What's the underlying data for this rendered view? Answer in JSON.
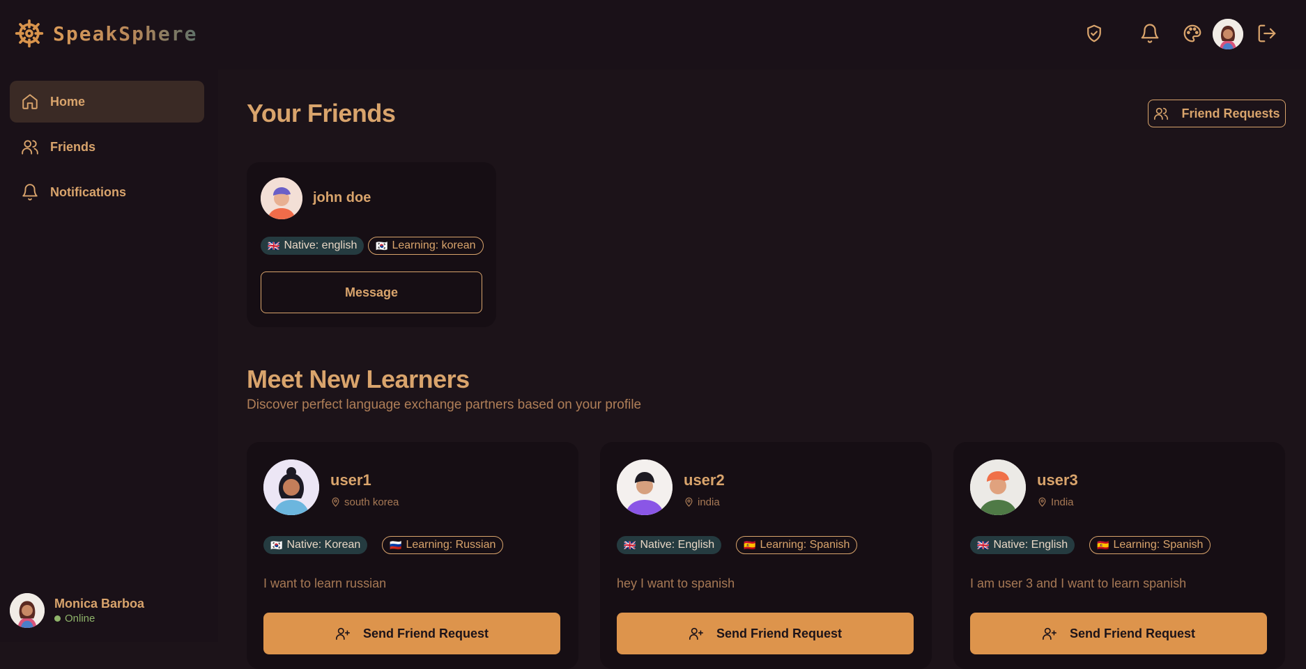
{
  "app": {
    "name": "SpeakSphere"
  },
  "sidebar": {
    "items": [
      {
        "label": "Home",
        "icon": "home-icon",
        "active": true
      },
      {
        "label": "Friends",
        "icon": "users-icon",
        "active": false
      },
      {
        "label": "Notifications",
        "icon": "bell-icon",
        "active": false
      }
    ],
    "user": {
      "name": "Monica Barboa",
      "status": "Online"
    }
  },
  "main": {
    "friends_title": "Your Friends",
    "friend_requests_label": "Friend Requests",
    "friends": [
      {
        "name": "john doe",
        "native": "Native: english",
        "native_flag": "🇬🇧",
        "learning": "Learning: korean",
        "learning_flag": "🇰🇷",
        "action": "Message"
      }
    ],
    "learners_title": "Meet New Learners",
    "learners_subtitle": "Discover perfect language exchange partners based on your profile",
    "learners": [
      {
        "name": "user1",
        "location": "south korea",
        "native": "Native: Korean",
        "native_flag": "🇰🇷",
        "learning": "Learning: Russian",
        "learning_flag": "🇷🇺",
        "bio": "I want to learn russian",
        "action": "Send Friend Request"
      },
      {
        "name": "user2",
        "location": "india",
        "native": "Native: English",
        "native_flag": "🇬🇧",
        "learning": "Learning: Spanish",
        "learning_flag": "🇪🇸",
        "bio": "hey I want to spanish",
        "action": "Send Friend Request"
      },
      {
        "name": "user3",
        "location": "India",
        "native": "Native: English",
        "native_flag": "🇬🇧",
        "learning": "Learning: Spanish",
        "learning_flag": "🇪🇸",
        "bio": "I am user 3 and I want to learn spanish",
        "action": "Send Friend Request"
      }
    ]
  },
  "colors": {
    "background": "#1c1319",
    "accent": "#d9a46c",
    "button": "#dd944c",
    "native_badge": "#253b40",
    "online": "#8fb46a"
  }
}
